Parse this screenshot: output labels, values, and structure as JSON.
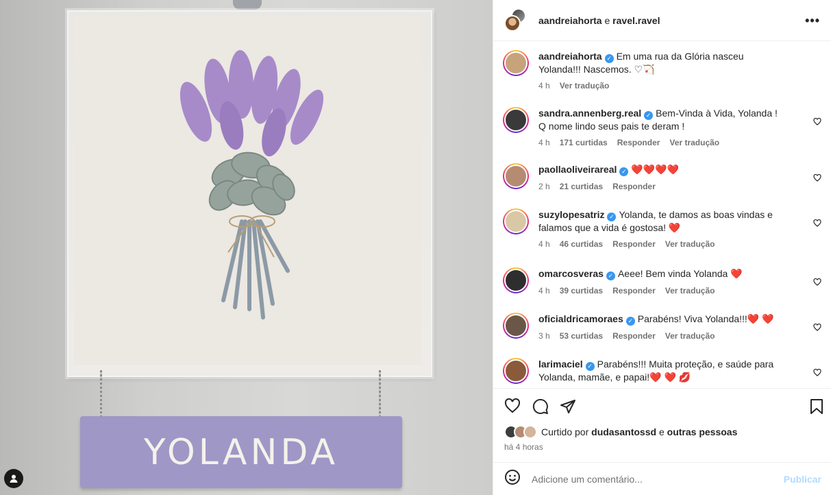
{
  "media": {
    "plaque_text": "YOLANDA"
  },
  "header": {
    "user1": "aandreiahorta",
    "and_word": "e",
    "user2": "ravel.ravel"
  },
  "comments": [
    {
      "user": "aandreiahorta",
      "text": "Em uma rua da Glória nasceu Yolanda!!! Nascemos. ♡🏹",
      "time": "4 h",
      "likes": "",
      "reply": "",
      "translate": "Ver tradução",
      "avatar_color": "#c7a37b",
      "has_heart": false
    },
    {
      "user": "sandra.annenberg.real",
      "text": "Bem-Vinda à Vida, Yolanda ! Q nome lindo seus pais te deram !",
      "time": "4 h",
      "likes": "171 curtidas",
      "reply": "Responder",
      "translate": "Ver tradução",
      "avatar_color": "#3a3a3a",
      "has_heart": true
    },
    {
      "user": "paollaoliveirareal",
      "text": "❤️❤️❤️❤️",
      "time": "2 h",
      "likes": "21 curtidas",
      "reply": "Responder",
      "translate": "",
      "avatar_color": "#b58c72",
      "has_heart": true
    },
    {
      "user": "suzylopesatriz",
      "text": "Yolanda, te damos as boas vindas e falamos que a vida é gostosa! ❤️",
      "time": "4 h",
      "likes": "46 curtidas",
      "reply": "Responder",
      "translate": "Ver tradução",
      "avatar_color": "#d9c8a6",
      "has_heart": true
    },
    {
      "user": "omarcosveras",
      "text": "Aeee! Bem vinda Yolanda ❤️",
      "time": "4 h",
      "likes": "39 curtidas",
      "reply": "Responder",
      "translate": "Ver tradução",
      "avatar_color": "#2e2e2e",
      "has_heart": true
    },
    {
      "user": "oficialdricamoraes",
      "text": "Parabéns! Viva Yolanda!!!❤️ ❤️",
      "time": "3 h",
      "likes": "53 curtidas",
      "reply": "Responder",
      "translate": "Ver tradução",
      "avatar_color": "#6a5747",
      "has_heart": true
    },
    {
      "user": "larimaciel",
      "text": "Parabéns!!! Muita proteção, e saúde para Yolanda, mamãe, e papai!❤️ ❤️ 💋",
      "time": "",
      "likes": "",
      "reply": "",
      "translate": "",
      "avatar_color": "#8a5a3a",
      "has_heart": true
    }
  ],
  "likes": {
    "prefix": "Curtido por",
    "user": "dudasantossd",
    "and_word": "e",
    "others": "outras pessoas"
  },
  "posted_ago": "há 4 horas",
  "add_comment": {
    "placeholder": "Adicione um comentário...",
    "publish": "Publicar"
  },
  "colors": {
    "accent": "#3897f0",
    "heart": "#ed4956",
    "plaque": "#9f97c6",
    "lavender": "#a78bc9"
  },
  "icons": [
    "more-icon",
    "like-icon",
    "comment-icon",
    "share-icon",
    "save-icon",
    "emoji-icon",
    "user-tag-icon"
  ]
}
